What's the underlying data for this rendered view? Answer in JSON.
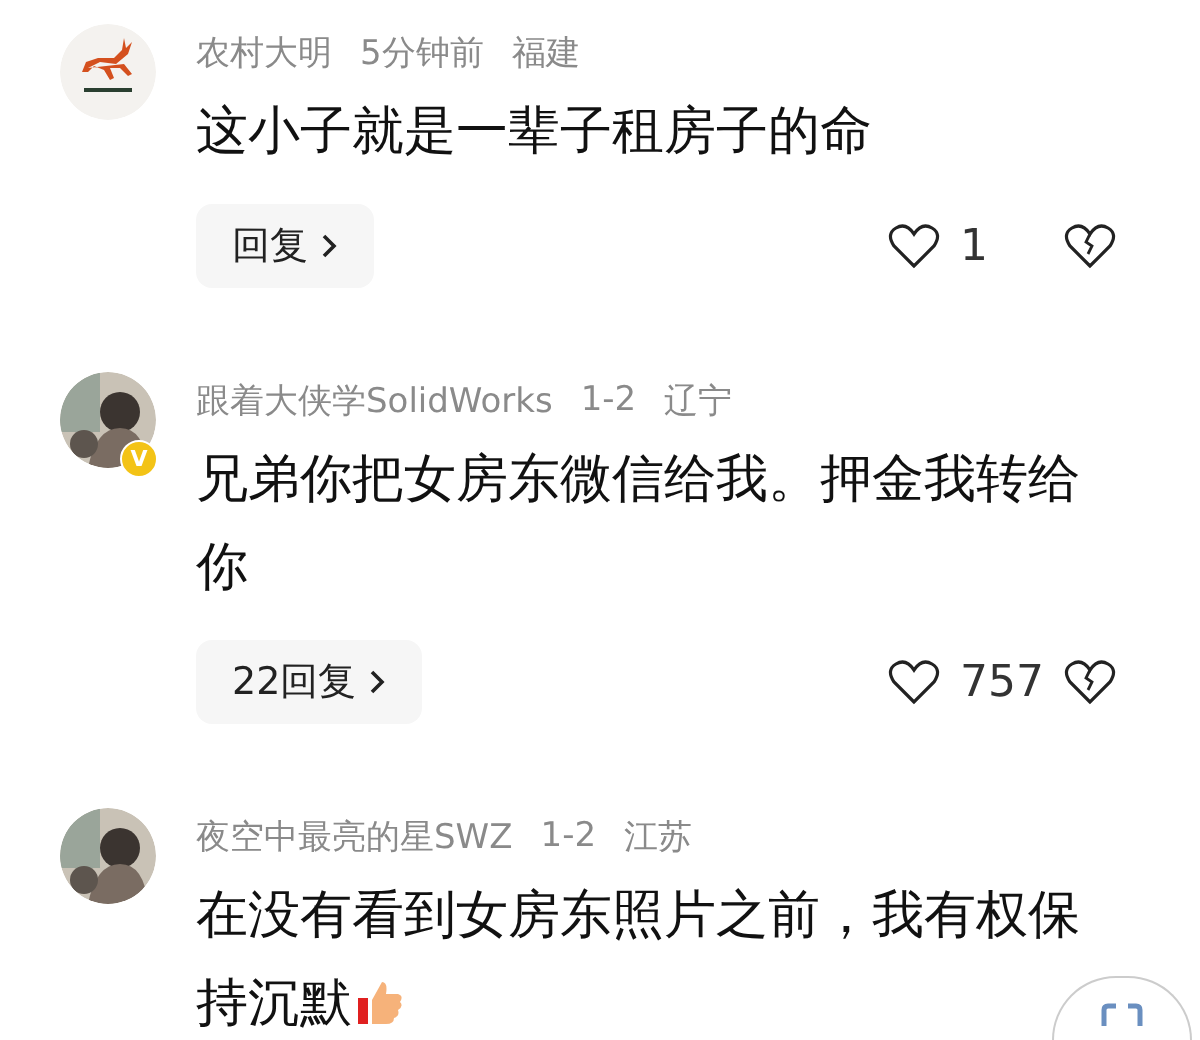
{
  "comments": [
    {
      "avatar": {
        "kind": "logo"
      },
      "author": "农村大明",
      "time": "5分钟前",
      "region": "福建",
      "text": "这小子就是一辈子租房子的命",
      "reply": "回复",
      "likes": "1"
    },
    {
      "badge": "V",
      "author": "跟着大侠学SolidWorks",
      "time": "1-2",
      "region": "辽宁",
      "text": "兄弟你把女房东微信给我。押金我转给你",
      "reply": "22回复",
      "likes": "757"
    },
    {
      "author": "夜空中最亮的星SWZ",
      "time": "1-2",
      "region": "江苏",
      "text": "在没有看到女房东照片之前，我有权保持沉默",
      "emoji": {
        "kind": "thumbs_up"
      }
    }
  ]
}
